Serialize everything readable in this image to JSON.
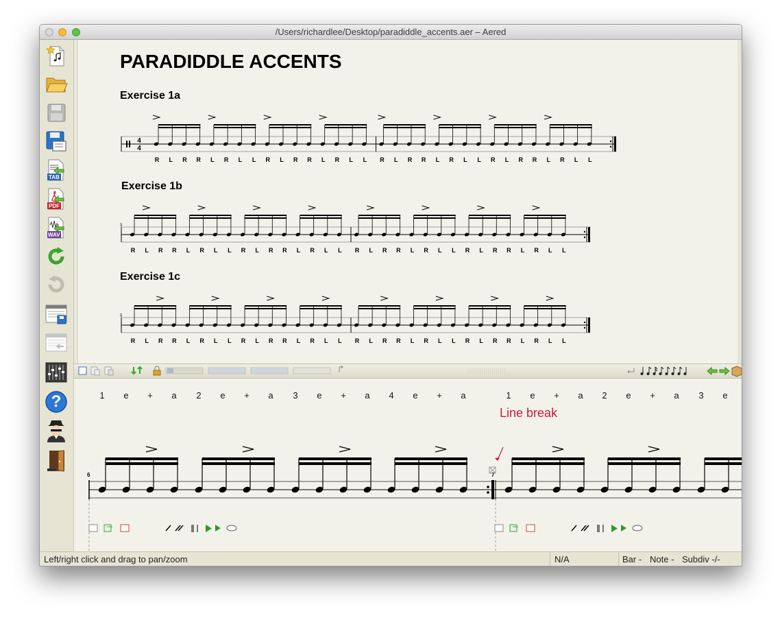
{
  "window": {
    "title": "/Users/richardlee/Desktop/paradiddle_accents.aer – Aered"
  },
  "sidebar": {
    "items": [
      {
        "name": "new-file-icon"
      },
      {
        "name": "open-folder-icon"
      },
      {
        "name": "save-icon"
      },
      {
        "name": "save-as-icon"
      },
      {
        "name": "export-tab-icon",
        "label": "TAB"
      },
      {
        "name": "export-pdf-icon",
        "label": "PDF"
      },
      {
        "name": "export-wav-icon",
        "label": "WAV"
      },
      {
        "name": "undo-icon"
      },
      {
        "name": "redo-icon"
      },
      {
        "name": "view-window-icon"
      },
      {
        "name": "view-window-back-icon"
      },
      {
        "name": "mixer-icon"
      },
      {
        "name": "help-icon",
        "label": "?"
      },
      {
        "name": "user-avatar-icon"
      },
      {
        "name": "exit-door-icon"
      }
    ]
  },
  "score": {
    "title": "PARADIDDLE ACCENTS",
    "exercises": [
      {
        "label": "Exercise 1a",
        "sticking": [
          "R",
          "L",
          "R",
          "R",
          "L",
          "R",
          "L",
          "L",
          "R",
          "L",
          "R",
          "R",
          "L",
          "R",
          "L",
          "L",
          "R",
          "L",
          "R",
          "R",
          "L",
          "R",
          "L",
          "L",
          "R",
          "L",
          "R",
          "R",
          "L",
          "R",
          "L",
          "L"
        ],
        "bar_number": "",
        "accents": [
          0,
          4,
          8,
          12
        ]
      },
      {
        "label": "Exercise 1b",
        "sticking": [
          "R",
          "L",
          "R",
          "R",
          "L",
          "R",
          "L",
          "L",
          "R",
          "L",
          "R",
          "R",
          "L",
          "R",
          "L",
          "L",
          "R",
          "L",
          "R",
          "R",
          "L",
          "R",
          "L",
          "L",
          "R",
          "L",
          "R",
          "R",
          "L",
          "R",
          "L",
          "L"
        ],
        "bar_number": "3",
        "accents": [
          1,
          5,
          9,
          13
        ]
      },
      {
        "label": "Exercise 1c",
        "sticking": [
          "R",
          "L",
          "R",
          "R",
          "L",
          "R",
          "L",
          "L",
          "R",
          "L",
          "R",
          "R",
          "L",
          "R",
          "L",
          "L",
          "R",
          "L",
          "R",
          "R",
          "L",
          "R",
          "L",
          "L",
          "R",
          "L",
          "R",
          "R",
          "L",
          "R",
          "L",
          "L"
        ],
        "bar_number": "5",
        "accents": [
          2,
          6,
          10,
          14
        ]
      }
    ],
    "time_signature": {
      "top": "4",
      "bottom": "4"
    }
  },
  "toolbar": {
    "icons": [
      "select-icon",
      "copy-icon",
      "paste-icon",
      "move-down-up-icon",
      "lock-icon",
      "corner-arrow-icon",
      "note-value-icons",
      "nav-left-arrow-icon",
      "nav-right-arrow-icon",
      "package-icon"
    ]
  },
  "editor": {
    "counts": [
      "1",
      "e",
      "+",
      "a",
      "2",
      "e",
      "+",
      "a",
      "3",
      "e",
      "+",
      "a",
      "4",
      "e",
      "+",
      "a",
      "1",
      "e",
      "+",
      "a",
      "2",
      "e",
      "+",
      "a",
      "3",
      "e"
    ],
    "bar_numbers": [
      "6",
      "7"
    ],
    "annotation": "Line break",
    "accent_positions": [
      2,
      6,
      10,
      14,
      18,
      22
    ]
  },
  "status": {
    "hint": "Left/right click and drag to pan/zoom",
    "position": "N/A",
    "bar": "Bar -",
    "note": "Note -",
    "subdiv": "Subdiv -/-"
  }
}
